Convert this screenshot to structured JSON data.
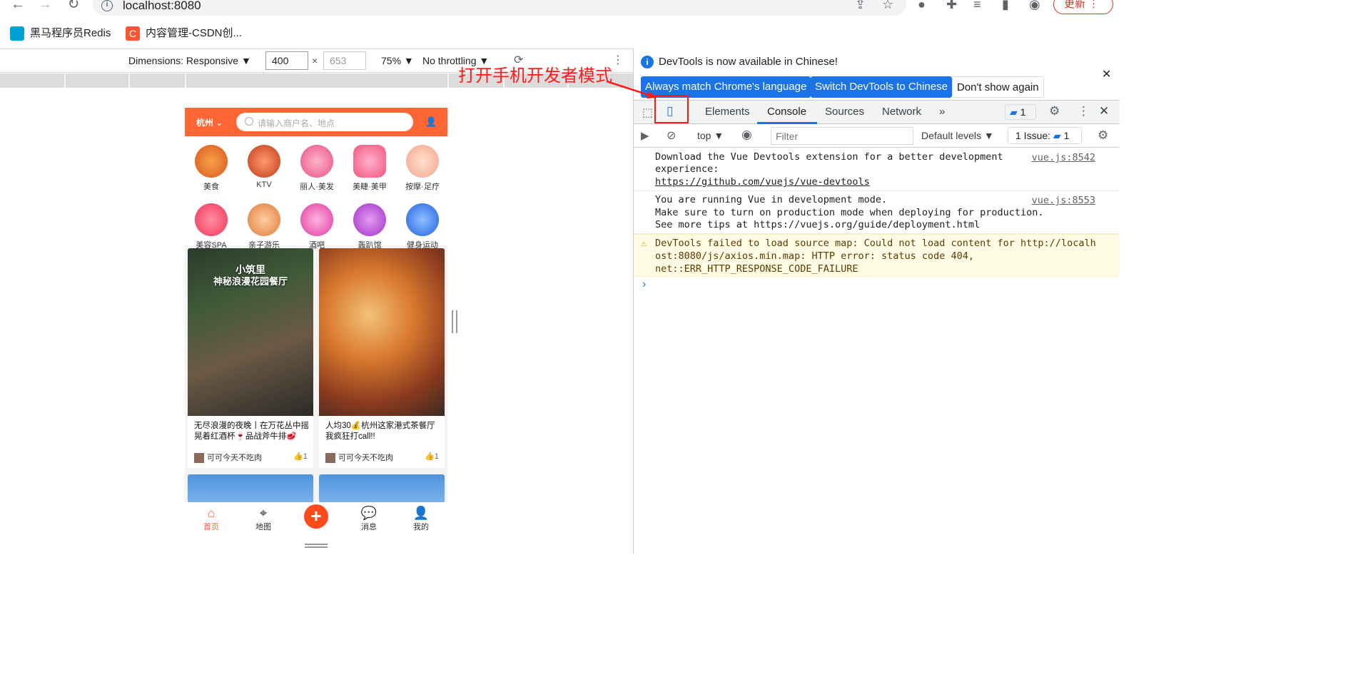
{
  "browser": {
    "url": "localhost:8080",
    "update_label": "更新",
    "bookmarks": [
      {
        "label": "黑马程序员Redis",
        "color": "#00a1d6"
      },
      {
        "label": "内容管理-CSDN创...",
        "color": "#fc5531"
      }
    ]
  },
  "device_toolbar": {
    "dimensions_label": "Dimensions: Responsive ▼",
    "width_value": "400",
    "height_value": "653",
    "times": "×",
    "zoom_label": "75% ▼",
    "throttle_label": "No throttling ▼"
  },
  "annotation": "打开手机开发者模式",
  "phone": {
    "city": "杭州",
    "search_placeholder": "请输入商户名、地点",
    "categories": [
      {
        "label": "美食"
      },
      {
        "label": "KTV"
      },
      {
        "label": "丽人·美发"
      },
      {
        "label": "美睫·美甲"
      },
      {
        "label": "按摩·足疗"
      },
      {
        "label": "美容SPA"
      },
      {
        "label": "亲子游乐"
      },
      {
        "label": "酒吧"
      },
      {
        "label": "轰趴馆"
      },
      {
        "label": "健身运动"
      }
    ],
    "cards": [
      {
        "overlay1": "小筑里",
        "overlay2": "神秘浪漫花园餐厅",
        "title": "无尽浪漫的夜晚丨在万花丛中摇晃着红酒杯🍷品战斧牛排🥩",
        "author": "可可今天不吃肉",
        "likes": "1"
      },
      {
        "overlay1": "",
        "overlay2": "",
        "title": "人均30💰杭州这家港式茶餐厅我疯狂打call!!",
        "author": "可可今天不吃肉",
        "likes": "1"
      }
    ],
    "tabs": [
      {
        "label": "首页"
      },
      {
        "label": "地图"
      },
      {
        "label": "消息"
      },
      {
        "label": "我的"
      }
    ]
  },
  "devtools": {
    "banner_text": "DevTools is now available in Chinese!",
    "btn_match": "Always match Chrome's language",
    "btn_switch": "Switch DevTools to Chinese",
    "btn_dont_show": "Don't show again",
    "tabs": [
      "Elements",
      "Console",
      "Sources",
      "Network"
    ],
    "issues_badge": "1",
    "console_context": "top ▼",
    "filter_placeholder": "Filter",
    "levels_label": "Default levels ▼",
    "issues_label": "1 Issue:",
    "issues_count": "1",
    "logs": [
      {
        "line1": "Download the Vue Devtools extension for a better development",
        "line2": "experience:",
        "line3": "https://github.com/vuejs/vue-devtools",
        "src": "vue.js:8542"
      },
      {
        "line1": "You are running Vue in development mode.",
        "line2": "Make sure to turn on production mode when deploying for production.",
        "line3": "See more tips at https://vuejs.org/guide/deployment.html",
        "src": "vue.js:8553"
      },
      {
        "line1": "DevTools failed to load source map: Could not load content for http://localh",
        "line2": "ost:8080/js/axios.min.map: HTTP error: status code 404,",
        "line3": "net::ERR_HTTP_RESPONSE_CODE_FAILURE",
        "src": ""
      }
    ],
    "prompt": "›"
  }
}
